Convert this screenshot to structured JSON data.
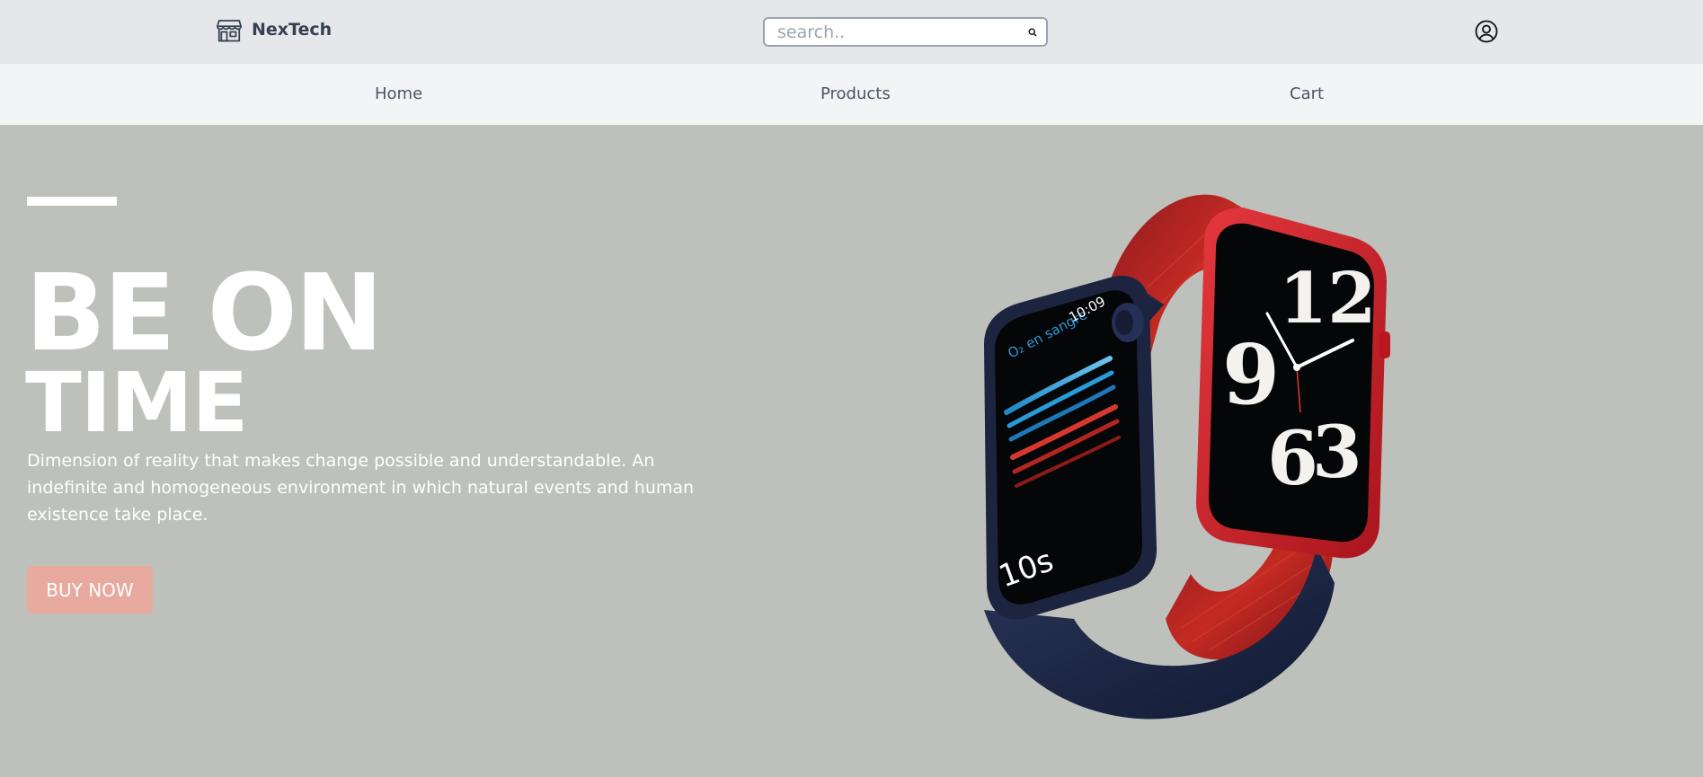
{
  "header": {
    "brand_name": "NexTech",
    "search": {
      "placeholder": "search..",
      "value": ""
    }
  },
  "nav": {
    "items": [
      {
        "label": "Home"
      },
      {
        "label": "Products"
      },
      {
        "label": "Cart"
      }
    ]
  },
  "hero": {
    "headline_line1": "BE ON",
    "headline_line2": "TIME",
    "description": "Dimension of reality that makes change possible and understandable. An indefinite and homogeneous environment in which natural events and human existence take place.",
    "cta_label": "BUY NOW",
    "product_image": {
      "left_watch": {
        "complication": "O₂ en sangre",
        "time": "10:09",
        "counter": "10s"
      },
      "right_watch": {
        "numerals": [
          "12",
          "9",
          "6",
          "3"
        ]
      }
    }
  },
  "colors": {
    "topbar_bg": "#e5e7eb",
    "navbar_bg": "#f3f4f6",
    "hero_bg": "#bec1bb",
    "cta_bg": "#e8a99f",
    "text_dark": "#374151",
    "watch_red": "#c8202a",
    "watch_navy": "#1c2440"
  },
  "icons": {
    "brand": "storefront-icon",
    "search": "search-icon",
    "account": "user-circle-icon"
  }
}
